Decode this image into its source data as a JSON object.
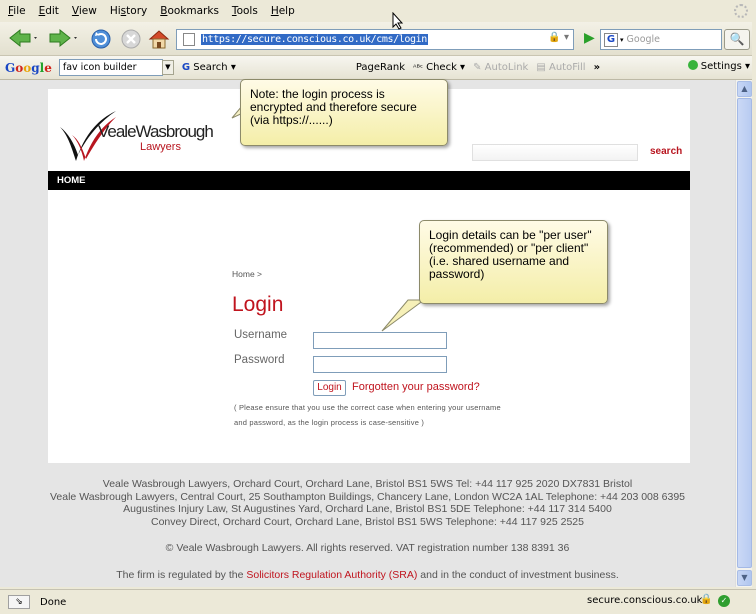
{
  "menubar": {
    "items": [
      {
        "pre": "",
        "u": "F",
        "post": "ile"
      },
      {
        "pre": "",
        "u": "E",
        "post": "dit"
      },
      {
        "pre": "",
        "u": "V",
        "post": "iew"
      },
      {
        "pre": "Hi",
        "u": "s",
        "post": "tory"
      },
      {
        "pre": "",
        "u": "B",
        "post": "ookmarks"
      },
      {
        "pre": "",
        "u": "T",
        "post": "ools"
      },
      {
        "pre": "",
        "u": "H",
        "post": "elp"
      }
    ]
  },
  "navbar": {
    "url": "https://secure.conscious.co.uk/cms/login",
    "search_placeholder": "Google"
  },
  "gtoolbar": {
    "logo": [
      "G",
      "o",
      "o",
      "g",
      "l",
      "e"
    ],
    "search_value": "fav icon builder",
    "search_label": "Search",
    "pagerank": "PageRank",
    "check_label": "Check",
    "autolink": "AutoLink",
    "autofill": "AutoFill",
    "more": "»",
    "settings": "Settings"
  },
  "page": {
    "logo_name": "VealeWasbrough",
    "logo_sub": "Lawyers",
    "search_label": "search",
    "nav_home": "HOME",
    "breadcrumb": "Home >",
    "login_title": "Login",
    "username_label": "Username",
    "password_label": "Password",
    "login_button": "Login",
    "forgot_link": "Forgotten your password?",
    "case_note_1": "( Please ensure that you use the correct case when entering your username",
    "case_note_2": "and password, as the login process is case-sensitive )"
  },
  "footer": {
    "line1": "Veale Wasbrough Lawyers, Orchard Court, Orchard Lane, Bristol BS1 5WS Tel: +44 117 925 2020 DX7831 Bristol",
    "line2": "Veale Wasbrough Lawyers, Central Court, 25 Southampton Buildings, Chancery Lane, London WC2A 1AL Telephone: +44 203 008 6395",
    "line3": "Augustines Injury Law, St Augustines Yard, Orchard Lane, Bristol BS1 5DE Telephone: +44 117 314 5400",
    "line4": "Convey Direct, Orchard Court, Orchard Lane, Bristol BS1 5WS Telephone: +44 117 925 2525",
    "copyright": "© Veale Wasbrough Lawyers. All rights reserved. VAT registration number 138 8391 36",
    "regulated_pre": "The firm is regulated by the",
    "regulated_link": "Solicitors Regulation Authority (SRA)",
    "regulated_post": "and in the conduct of investment business."
  },
  "callouts": {
    "https_note": "Note: the login process is encrypted and therefore secure (via https://......)",
    "login_note": "Login details can be \"per user\" (recommended) or \"per client\" (i.e. shared username and password)"
  },
  "status": {
    "text": "Done",
    "url": "secure.conscious.co.uk"
  },
  "colors": {
    "brand_red": "#c0141e",
    "url_highlight": "#316ac5"
  }
}
